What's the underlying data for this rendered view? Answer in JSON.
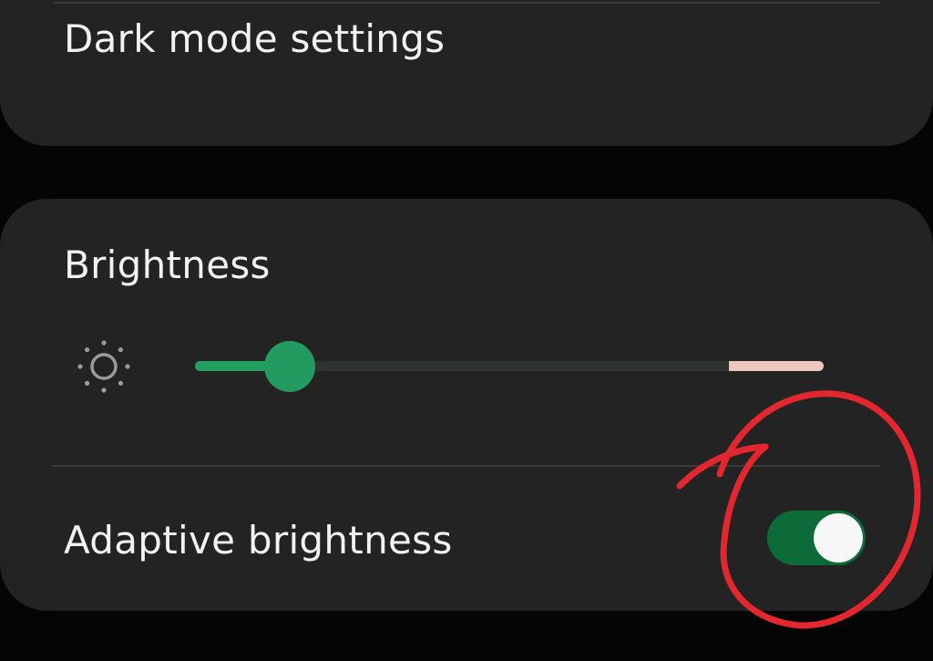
{
  "dark_mode": {
    "label": "Dark mode settings"
  },
  "brightness": {
    "label": "Brightness",
    "icon": "sun-icon",
    "level_fraction": 0.15,
    "colors": {
      "fill": "#249f62",
      "track": "#2d332f",
      "cap": "#efc6c0",
      "thumb": "#239a5f"
    }
  },
  "adaptive_brightness": {
    "label": "Adaptive brightness",
    "enabled": true,
    "colors": {
      "on_track": "#0d6b3a",
      "knob": "#f7f7f7"
    }
  },
  "annotation": {
    "shape": "hand-drawn circle",
    "color": "#e3272f"
  },
  "theme": {
    "background": "#050505",
    "card": "#232323",
    "text": "#f2f2f2"
  }
}
